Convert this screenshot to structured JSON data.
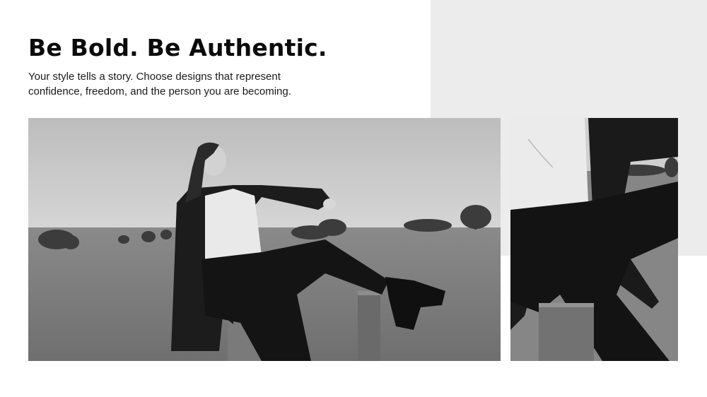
{
  "slide": {
    "title": "Be Bold. Be Authentic.",
    "subtitle_line1": "Your style tells a story. Choose designs that represent",
    "subtitle_line2": "confidence, freedom, and the person you are becoming."
  },
  "colors": {
    "background": "#ffffff",
    "panel": "#ececec",
    "text": "#0b0b0b"
  }
}
